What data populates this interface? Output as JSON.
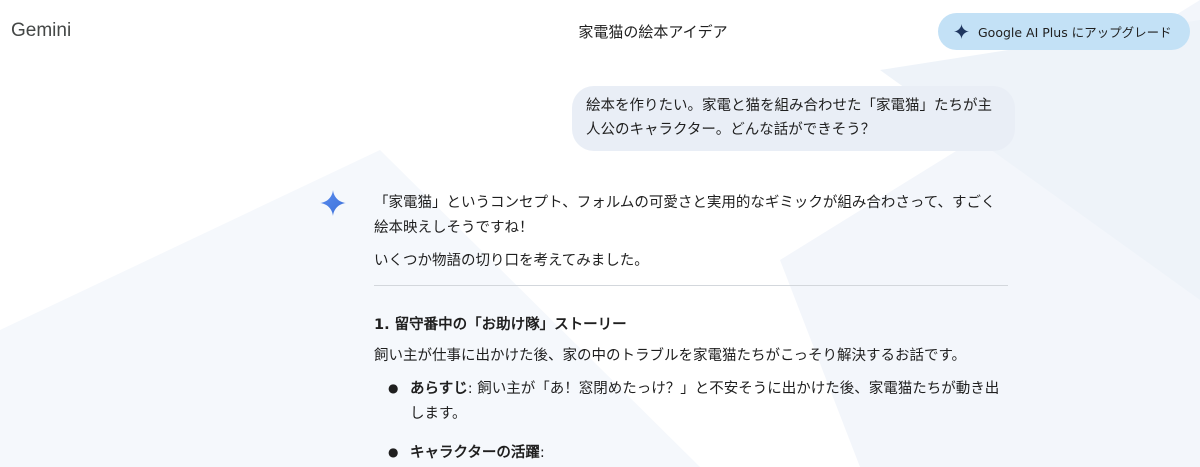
{
  "header": {
    "app_title": "Gemini",
    "conversation_title": "家電猫の絵本アイデア",
    "upgrade_button": {
      "label": "Google AI Plus にアップグレード",
      "icon": "sparkle-icon"
    }
  },
  "user_message": {
    "lines": [
      "絵本を作りたい。家電と猫を組み合わせた「家電猫」たちが主",
      "人公のキャラクター。どんな話ができそう？"
    ]
  },
  "model_response": {
    "avatar_icon": "gemini-sparkle-icon",
    "intro_lines": [
      "「家電猫」というコンセプト、フォルムの可愛さと実用的なギミックが組み合わさって、すごく",
      "絵本映えしそうですね！"
    ],
    "lead": "いくつか物語の切り口を考えてみました。",
    "section": {
      "heading": "1. 留守番中の「お助け隊」ストーリー",
      "description": "飼い主が仕事に出かけた後、家の中のトラブルを家電猫たちがこっそり解決するお話です。",
      "bullets": [
        {
          "label": "あらすじ",
          "text_lines": [
            ": 飼い主が「あ！窓閉めたっけ？」と不安そうに出かけた後、家電猫たちが動き出",
            "します。"
          ]
        },
        {
          "label": "キャラクターの活躍",
          "text_lines": [
            ":"
          ]
        }
      ]
    }
  },
  "colors": {
    "upgrade_button_bg": "#c3e1f6",
    "user_bubble_bg": "#e9eef6",
    "sparkle_blue": "#4285f4",
    "background_shape": "#f2f6fb"
  }
}
